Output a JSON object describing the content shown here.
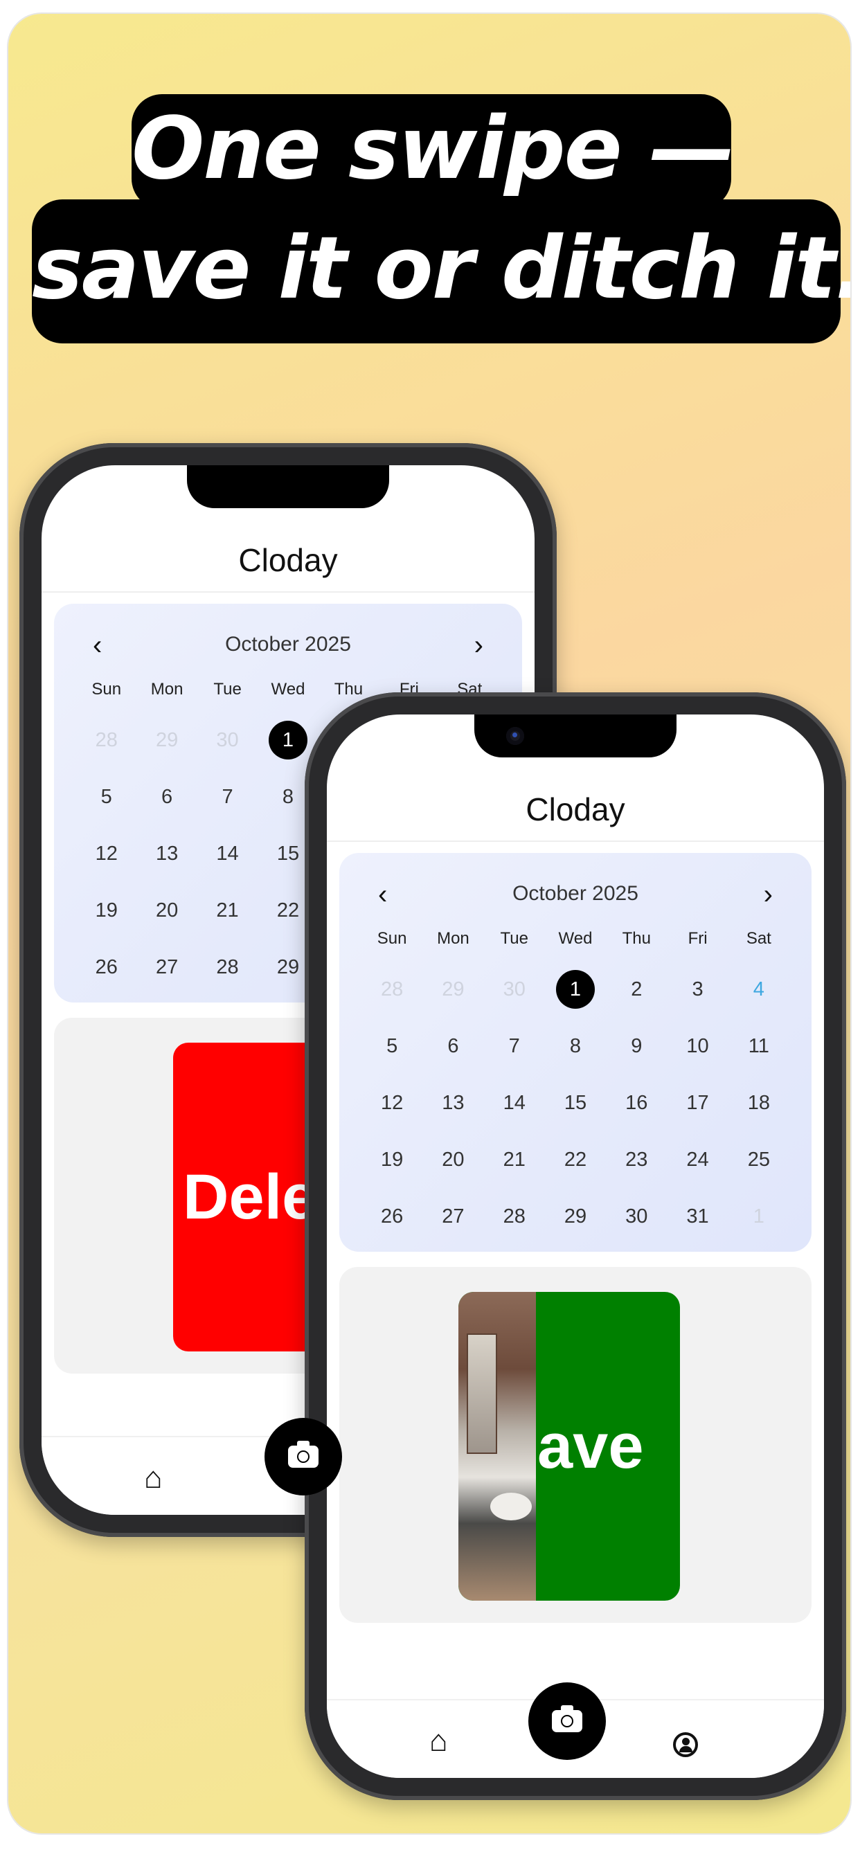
{
  "headline": {
    "line1": "One swipe —",
    "line2": "save it or ditch it."
  },
  "app": {
    "title": "Cloday"
  },
  "calendar": {
    "month_label": "October 2025",
    "prev_icon": "chevron-left-icon",
    "next_icon": "chevron-right-icon",
    "weekdays": [
      "Sun",
      "Mon",
      "Tue",
      "Wed",
      "Thu",
      "Fri",
      "Sat"
    ],
    "weeks": [
      [
        "28",
        "29",
        "30",
        "1",
        "2",
        "3",
        "4"
      ],
      [
        "5",
        "6",
        "7",
        "8",
        "9",
        "10",
        "11"
      ],
      [
        "12",
        "13",
        "14",
        "15",
        "16",
        "17",
        "18"
      ],
      [
        "19",
        "20",
        "21",
        "22",
        "23",
        "24",
        "25"
      ],
      [
        "26",
        "27",
        "28",
        "29",
        "30",
        "31",
        "1"
      ]
    ],
    "selected_day": "1",
    "highlight_day": "4",
    "colors": {
      "selected": "#000000",
      "highlight": "#3ea8e0",
      "muted": "#cfd3de"
    }
  },
  "back_phone": {
    "card_label": "Dele",
    "card_color": "#ff0000"
  },
  "front_phone": {
    "card_label": "ave",
    "card_color": "#008000"
  },
  "tabbar": {
    "home_icon": "home-icon",
    "camera_icon": "camera-icon",
    "profile_icon": "profile-icon"
  }
}
